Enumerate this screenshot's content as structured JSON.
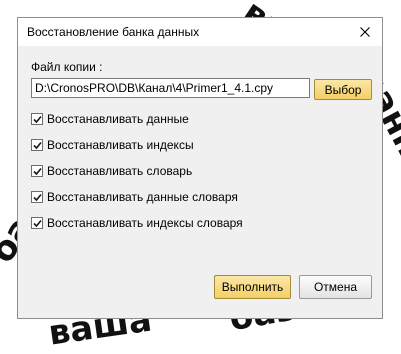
{
  "window": {
    "title": "Восстановление банка данных"
  },
  "file": {
    "label": "Файл копии :",
    "path": "D:\\CronosPRO\\DB\\Канал\\4\\Primer1_4.1.cpy",
    "browse_label": "Выбор"
  },
  "options": [
    {
      "label": "Восстанавливать данные",
      "checked": true
    },
    {
      "label": "Восстанавливать индексы",
      "checked": true
    },
    {
      "label": "Восстанавливать словарь",
      "checked": true
    },
    {
      "label": "Восстанавливать данные словаря",
      "checked": true
    },
    {
      "label": "Восстанавливать индексы словаря",
      "checked": true
    }
  ],
  "actions": {
    "run_label": "Выполнить",
    "cancel_label": "Отмена"
  },
  "colors": {
    "accent_button": "#f3cf66",
    "dialog_bg": "#f0f0f0"
  }
}
